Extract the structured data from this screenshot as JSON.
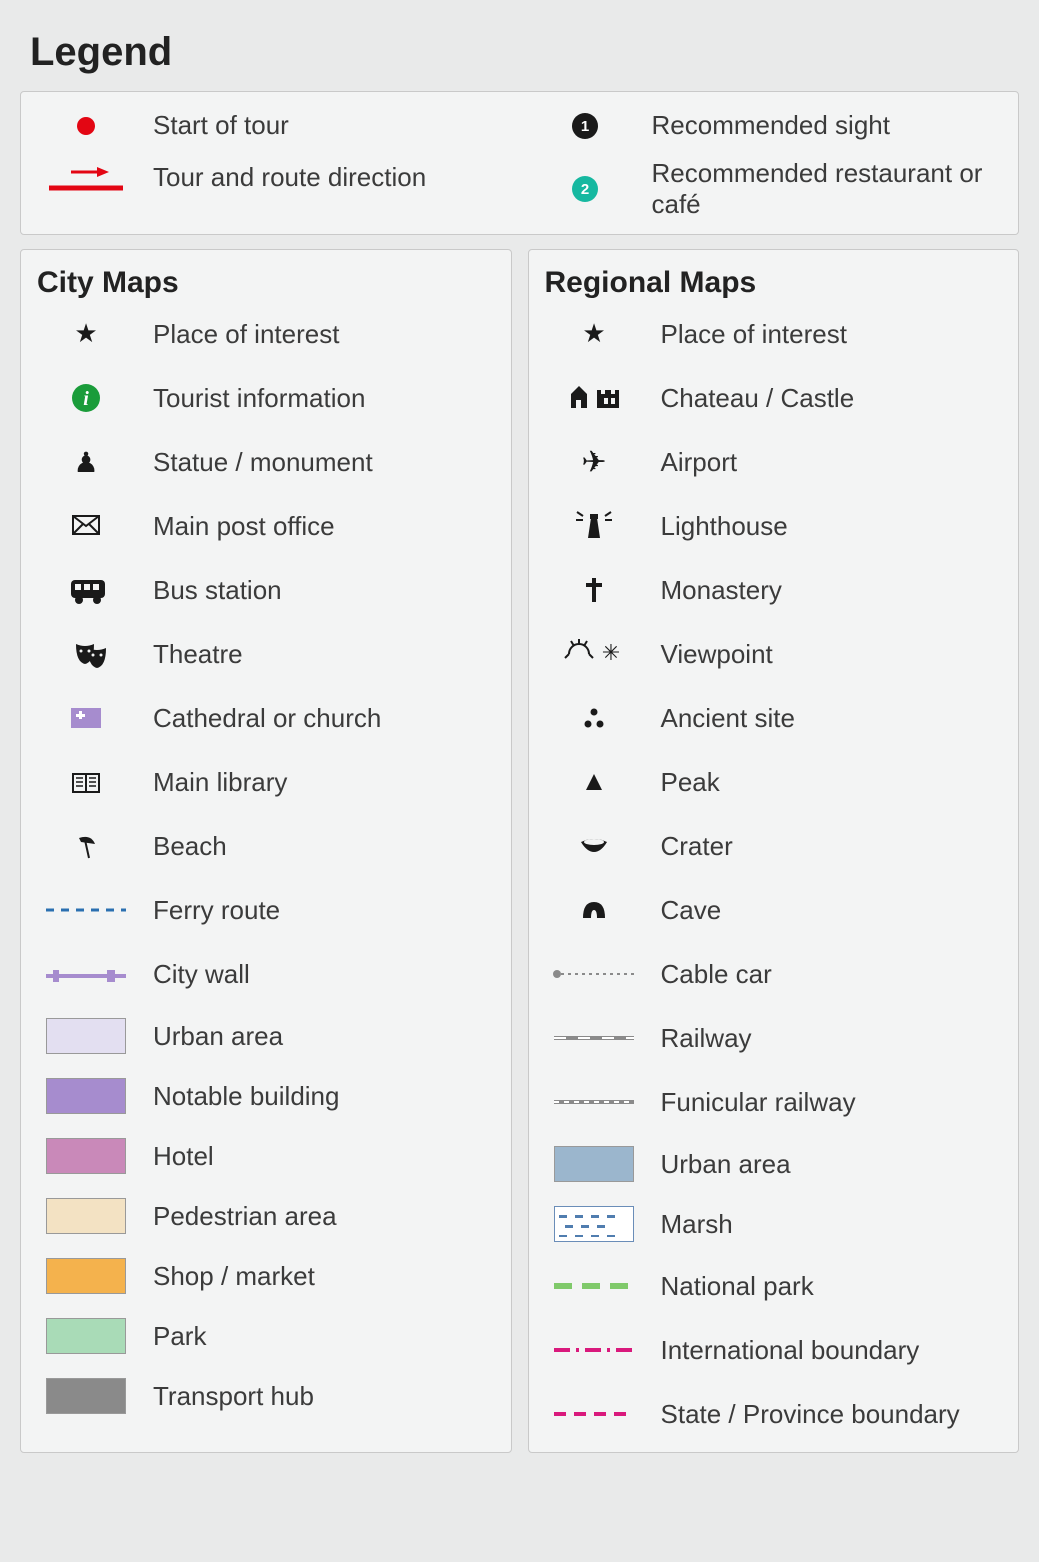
{
  "title": "Legend",
  "top": {
    "left": [
      {
        "icon": "start-dot",
        "label": "Start of tour"
      },
      {
        "icon": "route-arrow",
        "label": "Tour and route direction"
      }
    ],
    "right": [
      {
        "icon": "num-black",
        "num": "1",
        "label": "Recommended sight"
      },
      {
        "icon": "num-teal",
        "num": "2",
        "label": "Recommended restaurant or café"
      }
    ]
  },
  "city": {
    "heading": "City Maps",
    "items": [
      {
        "icon": "star",
        "label": "Place of interest"
      },
      {
        "icon": "info",
        "label": "Tourist information"
      },
      {
        "icon": "statue",
        "label": "Statue / monument"
      },
      {
        "icon": "post",
        "label": "Main post office"
      },
      {
        "icon": "bus",
        "label": "Bus station"
      },
      {
        "icon": "theatre",
        "label": "Theatre"
      },
      {
        "icon": "church",
        "label": "Cathedral or church"
      },
      {
        "icon": "library",
        "label": "Main library"
      },
      {
        "icon": "beach",
        "label": "Beach"
      },
      {
        "icon": "ferry",
        "label": "Ferry route"
      },
      {
        "icon": "citywall",
        "label": "City wall"
      },
      {
        "swatch": "sw-urban-city",
        "label": "Urban area"
      },
      {
        "swatch": "sw-notable",
        "label": "Notable building"
      },
      {
        "swatch": "sw-hotel",
        "label": "Hotel"
      },
      {
        "swatch": "sw-ped",
        "label": "Pedestrian area"
      },
      {
        "swatch": "sw-shop",
        "label": "Shop / market"
      },
      {
        "swatch": "sw-park",
        "label": "Park"
      },
      {
        "swatch": "sw-transport",
        "label": "Transport hub"
      }
    ]
  },
  "regional": {
    "heading": "Regional Maps",
    "items": [
      {
        "icon": "star",
        "label": "Place of interest"
      },
      {
        "icon": "chateau",
        "label": "Chateau / Castle"
      },
      {
        "icon": "airport",
        "label": "Airport"
      },
      {
        "icon": "lighthouse",
        "label": "Lighthouse"
      },
      {
        "icon": "monastery",
        "label": "Monastery"
      },
      {
        "icon": "viewpoint",
        "label": "Viewpoint"
      },
      {
        "icon": "ancient",
        "label": "Ancient site"
      },
      {
        "icon": "peak",
        "label": "Peak"
      },
      {
        "icon": "crater",
        "label": "Crater"
      },
      {
        "icon": "cave",
        "label": "Cave"
      },
      {
        "icon": "cablecar",
        "label": "Cable car"
      },
      {
        "icon": "railway",
        "label": "Railway"
      },
      {
        "icon": "funicular",
        "label": "Funicular railway"
      },
      {
        "swatch": "sw-urban-reg",
        "label": "Urban area"
      },
      {
        "swatch": "sw-marsh",
        "label": "Marsh"
      },
      {
        "icon": "natpark",
        "label": "National park"
      },
      {
        "icon": "intl",
        "label": "International boundary"
      },
      {
        "icon": "state",
        "label": "State / Province boundary"
      }
    ]
  }
}
